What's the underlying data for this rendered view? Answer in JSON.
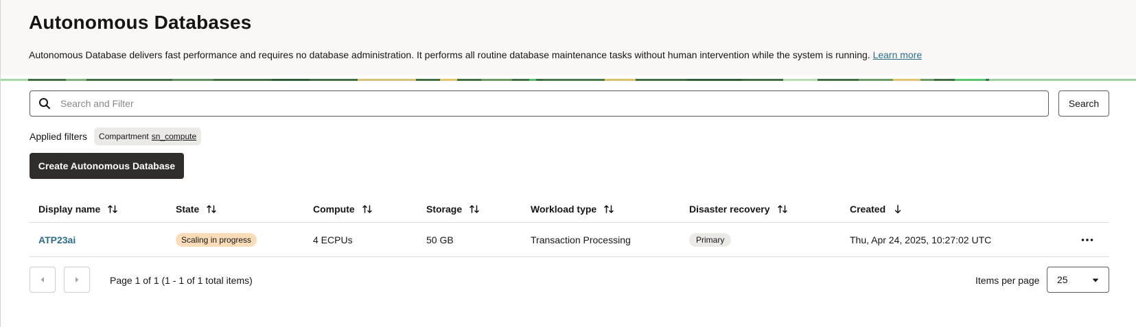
{
  "header": {
    "title": "Autonomous Databases",
    "description": "Autonomous Database delivers fast performance and requires no database administration. It performs all routine database maintenance tasks without human intervention while the system is running.",
    "learn_more": "Learn more"
  },
  "search": {
    "placeholder": "Search and Filter",
    "value": "",
    "button_label": "Search"
  },
  "filters": {
    "label": "Applied filters",
    "chips": [
      {
        "key": "Compartment",
        "value": "sn_compute"
      }
    ]
  },
  "actions": {
    "create_label": "Create Autonomous Database"
  },
  "table": {
    "columns": [
      {
        "label": "Display name",
        "sort": "both"
      },
      {
        "label": "State",
        "sort": "both"
      },
      {
        "label": "Compute",
        "sort": "both"
      },
      {
        "label": "Storage",
        "sort": "both"
      },
      {
        "label": "Workload type",
        "sort": "both"
      },
      {
        "label": "Disaster recovery",
        "sort": "both"
      },
      {
        "label": "Created",
        "sort": "descending"
      }
    ],
    "rows": [
      {
        "display_name": "ATP23ai",
        "state": "Scaling in progress",
        "compute": "4 ECPUs",
        "storage": "50 GB",
        "workload_type": "Transaction Processing",
        "disaster_recovery": "Primary",
        "created": "Thu, Apr 24, 2025, 10:27:02 UTC"
      }
    ]
  },
  "pagination": {
    "page_info": "Page 1 of 1 (1 - 1 of 1 total items)",
    "items_per_page_label": "Items per page",
    "items_per_page": "25"
  },
  "colors": {
    "accent_link": "#2b6d8a",
    "primary_button": "#312d2a",
    "state_badge": "#fbdcb8",
    "header_bg": "#f9f8f6"
  }
}
